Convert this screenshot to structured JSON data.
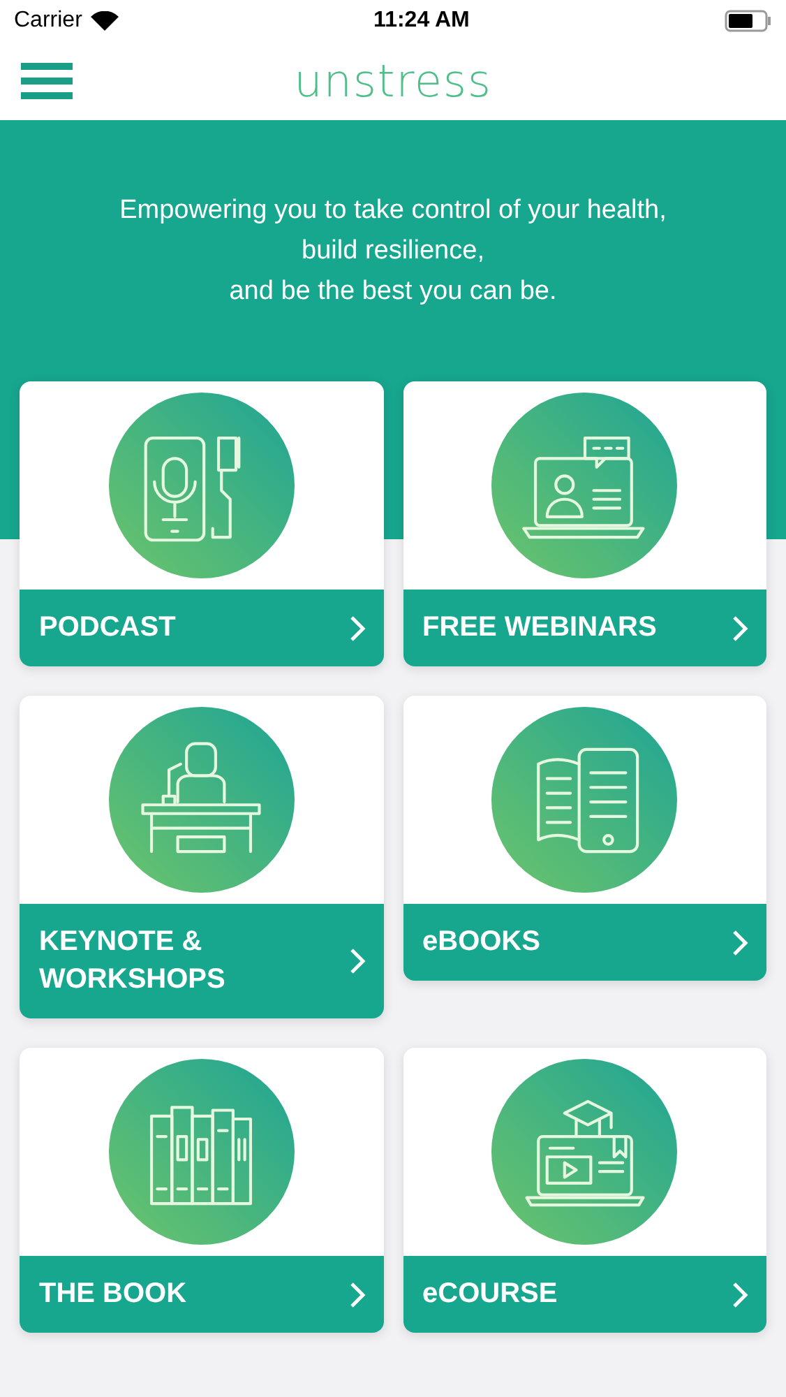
{
  "status_bar": {
    "carrier": "Carrier",
    "time": "11:24 AM"
  },
  "header": {
    "title": "unstress"
  },
  "tagline": [
    "Empowering you to take control of your health,",
    "build resilience,",
    "and be the best you can be."
  ],
  "cards": [
    {
      "label": "PODCAST"
    },
    {
      "label": "FREE WEBINARS"
    },
    {
      "label": "KEYNOTE & WORKSHOPS"
    },
    {
      "label": "eBOOKS"
    },
    {
      "label": "THE BOOK"
    },
    {
      "label": "eCOURSE"
    }
  ]
}
